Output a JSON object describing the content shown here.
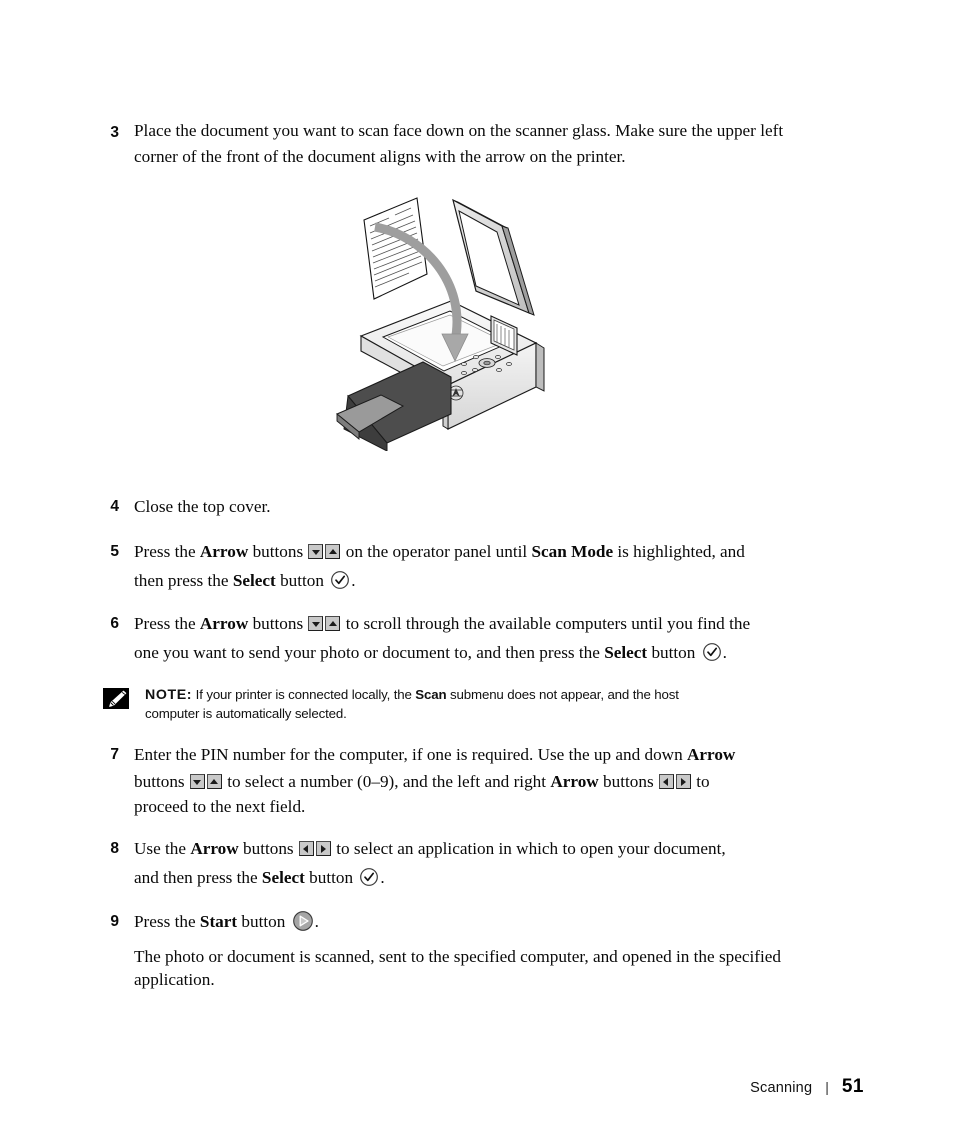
{
  "document": {
    "section": "Scanning",
    "page_number": "51",
    "footer_separator": "|"
  },
  "steps": [
    {
      "number": "3",
      "lines": [
        "Place the document you want to scan face down on the scanner glass. Make sure the upper",
        "left corner of the front of the document aligns with the arrow on the printer."
      ]
    },
    {
      "number": "4",
      "text": "Close the top cover."
    },
    {
      "number": "5",
      "t1": "Press the ",
      "b1": "Arrow",
      "t2": " buttons ",
      "icons1": [
        "arrow-down-button",
        "arrow-up-button"
      ],
      "t3": " on the operator panel until ",
      "b2": "Scan Mode",
      "t4": " is highlighted, and",
      "t5": "then press the ",
      "b3": "Select",
      "t6": " button ",
      "icons2": [
        "select-button"
      ],
      "t7": "."
    },
    {
      "number": "6",
      "t1": "Press the ",
      "b1": "Arrow",
      "t2": " buttons ",
      "icons1": [
        "arrow-down-button",
        "arrow-up-button"
      ],
      "t3": " to scroll through the available computers until you find the",
      "t4": "one you want to send your photo or document to, and then press the ",
      "b2": "Select",
      "t5": " button ",
      "icons2": [
        "select-button"
      ],
      "t6": "."
    },
    {
      "number": "7",
      "t1": "Enter the PIN number for the computer, if one is required. Use the up and down ",
      "b1": "Arrow",
      "t2": "buttons ",
      "icons1": [
        "arrow-down-button",
        "arrow-up-button"
      ],
      "t3": " to select a number (0–9), and the left and right ",
      "b2": "Arrow",
      "t4": " buttons ",
      "icons2": [
        "arrow-left-button",
        "arrow-right-button"
      ],
      "t5": " to",
      "t6": "proceed to the next field."
    },
    {
      "number": "8",
      "t1": "Use the ",
      "b1": "Arrow",
      "t2": " buttons ",
      "icons1": [
        "arrow-left-button",
        "arrow-right-button"
      ],
      "t3": " to select an application in which to open your document,",
      "t4": "and then press the ",
      "b2": "Select",
      "t5": " button ",
      "icons2": [
        "select-button"
      ],
      "t6": "."
    },
    {
      "number": "9",
      "t1": "Press the ",
      "b1": "Start",
      "t2": " button ",
      "icons1": [
        "start-button"
      ],
      "t3": ".",
      "result_lines": [
        "The photo or document is scanned, sent to the specified computer, and opened in the",
        "specified application."
      ]
    }
  ],
  "note": {
    "icon": "note-pencil-icon",
    "label": "NOTE:",
    "t1": " If your printer is connected locally, the ",
    "b1": "Scan",
    "t2": " submenu does not appear, and the host",
    "t3": "computer is automatically selected."
  },
  "illustration": {
    "name": "scanner-place-document-illustration",
    "description": "All-in-one printer with scanner lid open, a document page above the glass and a curved arrow showing placement direction"
  },
  "colors": {
    "text": "#0a0a0a",
    "button_face": "#c9c9c9",
    "button_border": "#4a4a4a",
    "arrow_gray": "#a8a8a8",
    "device_light": "#f2f2f2",
    "device_mid": "#d2d2d2",
    "device_dark": "#4a4a4a",
    "tray_dark": "#4d4d4d"
  }
}
